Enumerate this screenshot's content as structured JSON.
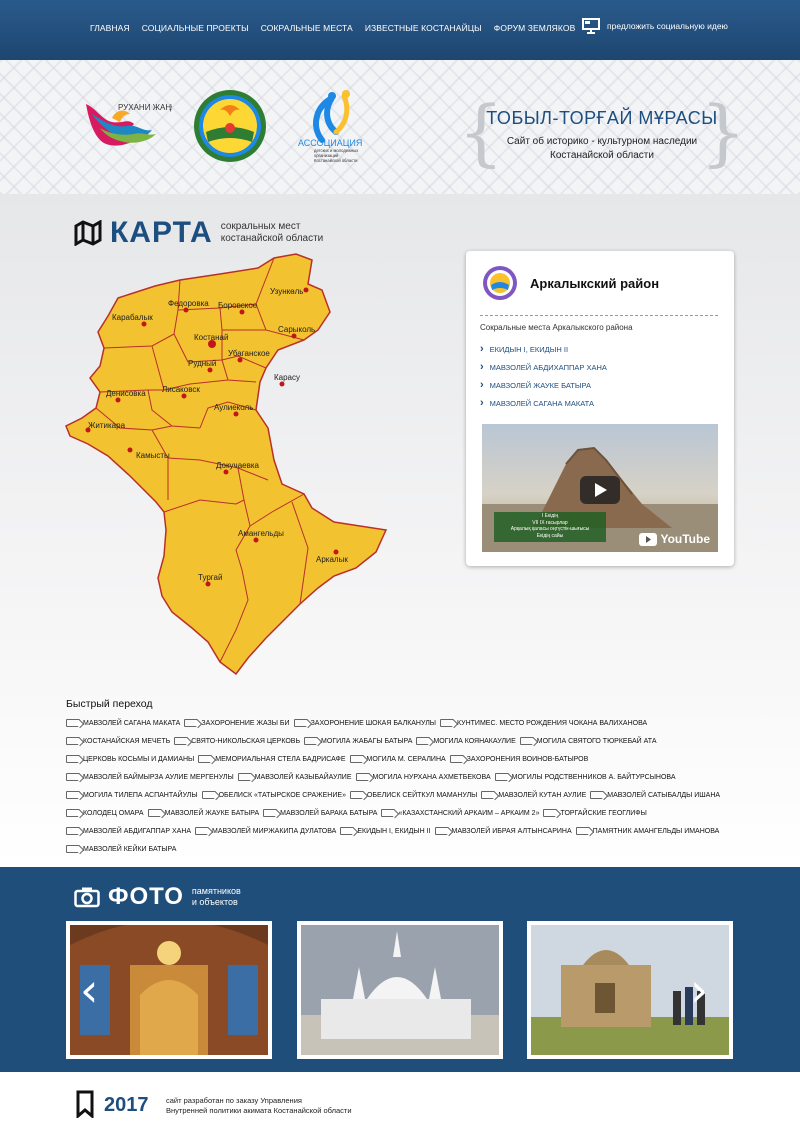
{
  "nav": [
    "ГЛАВНАЯ",
    "СОЦИАЛЬНЫЕ ПРОЕКТЫ",
    "СОКРАЛЬНЫЕ МЕСТА",
    "ИЗВЕСТНЫЕ КОСТАНАЙЦЫ",
    "ФОРУМ ЗЕМЛЯКОВ"
  ],
  "idea": "предложить социальную идею",
  "logos": {
    "ruhani": "РУХАНИ ЖАҢҒЫРУ",
    "assoc": "АССОЦИАЦИЯ",
    "assoc_sub": "детских и молодежных организаций Костанайской области"
  },
  "site": {
    "title": "ТОБЫЛ-ТОРҒАЙ МҰРАСЫ",
    "desc1": "Сайт об историко - культурном наследии",
    "desc2": "Костанайской области"
  },
  "map": {
    "title": "КАРТА",
    "sub1": "сокральных мест",
    "sub2": "костанайской области",
    "districts": [
      "Карабалык",
      "Федоровка",
      "Боровское",
      "Узункөль",
      "Сарыколь",
      "Костанай",
      "Убаганское",
      "Рудный",
      "Денисовка",
      "Лисаковск",
      "Карасу",
      "Аулиеколь",
      "Житикара",
      "Камысты",
      "Докучаевка",
      "Амангельды",
      "Тургай",
      "Аркалык"
    ]
  },
  "panel": {
    "title": "Аркалыкский район",
    "caption": "Сокральные места Аркалыкского района",
    "links": [
      "ЕКИДЫН I, ЕКИДЫН II",
      "МАВЗОЛЕЙ АБДИХАППАР ХАНА",
      "МАВЗОЛЕЙ ЖАУКЕ БАТЫРА",
      "МАВЗОЛЕЙ САГАНА МАКАТА"
    ],
    "video": {
      "l1": "I Екідің",
      "l2": "VII IX ғасырлар",
      "l3": "Арқалық қаласы оңтүстік-шығысы",
      "l4": "Екідің сайы",
      "brand": "YouTube"
    }
  },
  "quick": {
    "title": "Быстрый переход",
    "items": [
      "МАВЗОЛЕЙ САГАНА МАКАТА",
      "ЗАХОРОНЕНИЕ ЖАЗЫ БИ",
      "ЗАХОРОНЕНИЕ ШОКАЯ БАЛКАНУЛЫ",
      "КУНТИМЕС. МЕСТО РОЖДЕНИЯ ЧОКАНА ВАЛИХАНОВА",
      "КОСТАНАЙСКАЯ МЕЧЕТЬ",
      "СВЯТО-НИКОЛЬСКАЯ ЦЕРКОВЬ",
      "МОГИЛА ЖАБАГЫ БАТЫРА",
      "МОГИЛА КОЯНАКАУЛИЕ",
      "МОГИЛА СВЯТОГО ТЮРКЕБАЙ АТА",
      "ЦЕРКОВЬ КОСЬМЫ И ДАМИАНЫ",
      "МЕМОРИАЛЬНАЯ СТЕЛА БАДРИСАФЕ",
      "МОГИЛА М. СЕРАЛИНА",
      "ЗАХОРОНЕНИЯ ВОИНОВ-БАТЫРОВ",
      "МАВЗОЛЕЙ БАЙМЫРЗА АУЛИЕ МЕРГЕНУЛЫ",
      "МАВЗОЛЕЙ КАЗЫБАЙАУЛИЕ",
      "МОГИЛА НУРХАНА АХМЕТБЕКОВА",
      "МОГИЛЫ РОДСТВЕННИКОВ А. БАЙТУРСЫНОВА",
      "МОГИЛА ТИЛЕПА АСПАНТАЙУЛЫ",
      "ОБЕЛИСК «ТАТЫРСКОЕ СРАЖЕНИЕ»",
      "ОБЕЛИСК СЕЙТКУЛ МАМАНУЛЫ",
      "МАВЗОЛЕЙ КУТАН АУЛИЕ",
      "МАВЗОЛЕЙ САТЫБАЛДЫ ИШАНА",
      "КОЛОДЕЦ ОМАРА",
      "МАВЗОЛЕЙ ЖАУКЕ БАТЫРА",
      "МАВЗОЛЕЙ БАРАКА БАТЫРА",
      "«КАЗАХСТАНСКИЙ АРКАИМ – АРКАИМ 2»",
      "ТОРГАЙСКИЕ ГЕОГЛИФЫ",
      "МАВЗОЛЕЙ АБДИГАППАР ХАНА",
      "МАВЗОЛЕЙ МИРЖАКИПА ДУЛАТОВА",
      "ЕКИДЫН I, ЕКИДЫН II",
      "МАВЗОЛЕЙ ИБРАЯ АЛТЫНСАРИНА",
      "ПАМЯТНИК АМАНГЕЛЬДЫ ИМАНОВА",
      "МАВЗОЛЕЙ КЕЙКИ БАТЫРА"
    ]
  },
  "photos": {
    "title": "ФОТО",
    "sub1": "памятников",
    "sub2": "и объектов"
  },
  "footer": {
    "year": "2017",
    "t1": "сайт разработан по заказу Управления",
    "t2": "Внутренней политики акимата Костанайской области"
  },
  "colors": {
    "topbar": "#1d4670",
    "accent": "#1d4e80",
    "map_fill": "#f2c230",
    "map_border": "#b9302a",
    "dot": "#c0171b",
    "photo_band": "#1f4e7a"
  }
}
